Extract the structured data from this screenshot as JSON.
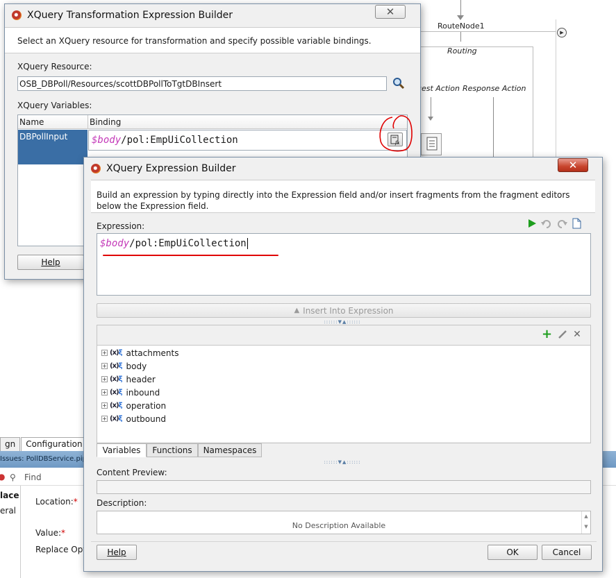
{
  "background": {
    "route_node_label": "RouteNode1",
    "routing_label": "Routing",
    "request_action_label": "uest Action",
    "response_action_label": "Response Action",
    "tabs": [
      "gn",
      "Configuration"
    ],
    "issues_label": "Issues: PollDBService.pip",
    "find_placeholder": "Find",
    "side_items": [
      "lace",
      "eral"
    ],
    "location_label": "Location:",
    "value_label": "Value:",
    "replace_opt_label": "Replace Opt"
  },
  "outer_dialog": {
    "title": "XQuery Transformation Expression Builder",
    "instructions": "Select an XQuery resource for transformation and specify possible variable bindings.",
    "resource_label": "XQuery Resource:",
    "resource_value": "OSB_DBPoll/Resources/scottDBPollToTgtDBInsert",
    "variables_label": "XQuery Variables:",
    "columns": [
      "Name",
      "Binding"
    ],
    "rows": [
      {
        "name": "DBPollInput",
        "binding_var": "$body",
        "binding_path": "/pol:EmpUiCollection"
      }
    ],
    "help_label": "Help"
  },
  "inner_dialog": {
    "title": "XQuery Expression Builder",
    "instructions": "Build an expression by typing directly into the Expression field and/or insert fragments from the fragment editors below the Expression field.",
    "expression_label": "Expression:",
    "expression_var": "$body",
    "expression_path": "/pol:EmpUiCollection",
    "insert_label": "Insert Into Expression",
    "tree_items": [
      "attachments",
      "body",
      "header",
      "inbound",
      "operation",
      "outbound"
    ],
    "tabs": [
      "Variables",
      "Functions",
      "Namespaces"
    ],
    "active_tab": "Variables",
    "content_preview_label": "Content Preview:",
    "description_label": "Description:",
    "description_text": "No Description Available",
    "help_label": "Help",
    "ok_label": "OK",
    "cancel_label": "Cancel"
  },
  "colors": {
    "var_color": "#c43ab9",
    "selection_blue": "#3a6ea5",
    "annotation_red": "#e00000",
    "run_green": "#1e9e1e"
  }
}
